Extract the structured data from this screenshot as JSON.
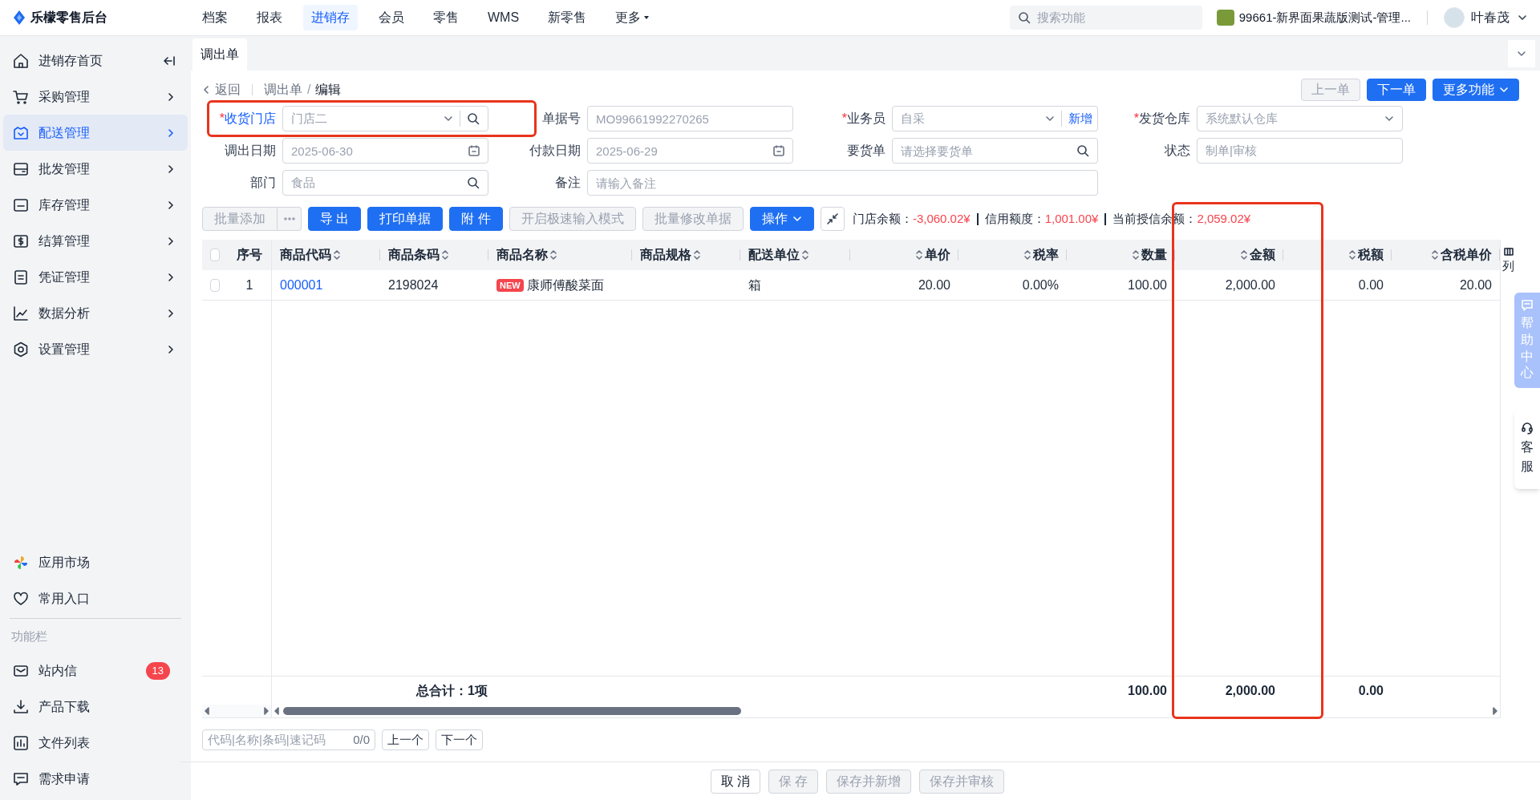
{
  "header": {
    "brand": "乐檬零售后台",
    "nav": [
      {
        "label": "档案",
        "selected": false,
        "has_menu": false
      },
      {
        "label": "报表",
        "selected": false,
        "has_menu": false
      },
      {
        "label": "进销存",
        "selected": true,
        "has_menu": false
      },
      {
        "label": "会员",
        "selected": false,
        "has_menu": false
      },
      {
        "label": "零售",
        "selected": false,
        "has_menu": false
      },
      {
        "label": "WMS",
        "selected": false,
        "has_menu": false
      },
      {
        "label": "新零售",
        "selected": false,
        "has_menu": false
      },
      {
        "label": "更多",
        "selected": false,
        "has_menu": true
      }
    ],
    "search_placeholder": "搜索功能",
    "store": "99661-新界面果蔬版测试-管理...",
    "user": "叶春茂"
  },
  "sidebar": {
    "menu": [
      {
        "label": "进销存首页",
        "selected": false
      },
      {
        "label": "采购管理",
        "selected": false
      },
      {
        "label": "配送管理",
        "selected": true
      },
      {
        "label": "批发管理",
        "selected": false
      },
      {
        "label": "库存管理",
        "selected": false
      },
      {
        "label": "结算管理",
        "selected": false
      },
      {
        "label": "凭证管理",
        "selected": false
      },
      {
        "label": "数据分析",
        "selected": false
      },
      {
        "label": "设置管理",
        "selected": false
      }
    ],
    "links": [
      {
        "label": "应用市场"
      },
      {
        "label": "常用入口"
      }
    ],
    "section_title": "功能栏",
    "tools": [
      {
        "label": "站内信",
        "badge": "13"
      },
      {
        "label": "产品下载"
      },
      {
        "label": "文件列表"
      },
      {
        "label": "需求申请"
      }
    ]
  },
  "page_tabs": [
    {
      "label": "调出单",
      "selected": true
    }
  ],
  "breadcrumb": {
    "back": "返回",
    "path": [
      "调出单",
      "编辑"
    ],
    "separator": "/"
  },
  "record_buttons": [
    {
      "label": "上一单",
      "kind": "default",
      "disabled": true
    },
    {
      "label": "下一单",
      "kind": "primary",
      "disabled": false
    },
    {
      "label": "更多功能",
      "kind": "primary_dropdown",
      "disabled": false
    }
  ],
  "form_fields": [
    {
      "label": "收货门店",
      "required_mark": "*",
      "kind": "select_search",
      "value": "门店二",
      "highlighted": true
    },
    {
      "label": "单据号",
      "kind": "text",
      "value": "MO99661992270265",
      "highlighted": false
    },
    {
      "label": "业务员",
      "required_mark": "*",
      "kind": "select_add",
      "value": "自采",
      "action": "新增",
      "highlighted": false
    },
    {
      "label": "发货仓库",
      "required_mark": "*",
      "kind": "select",
      "value": "系统默认仓库",
      "highlighted": false
    },
    {
      "label": "调出日期",
      "kind": "date",
      "value": "2025-06-30",
      "highlighted": false
    },
    {
      "label": "付款日期",
      "kind": "date",
      "value": "2025-06-29",
      "highlighted": false
    },
    {
      "label": "要货单",
      "kind": "search",
      "placeholder": "请选择要货单",
      "highlighted": false
    },
    {
      "label": "状态",
      "kind": "text",
      "value": "制单|审核",
      "highlighted": false
    },
    {
      "label": "部门",
      "kind": "search",
      "value": "食品",
      "highlighted": false
    },
    {
      "label": "备注",
      "kind": "remark",
      "placeholder": "请输入备注",
      "highlighted": false
    }
  ],
  "toolbar": {
    "buttons": [
      {
        "label": "批量添加",
        "kind": "default",
        "disabled": true
      },
      {
        "kind": "more",
        "disabled": true
      },
      {
        "label": "导 出",
        "kind": "primary",
        "disabled": false
      },
      {
        "label": "打印单据",
        "kind": "primary",
        "disabled": false
      },
      {
        "label": "附 件",
        "kind": "primary",
        "disabled": false
      },
      {
        "label": "开启极速输入模式",
        "kind": "default",
        "disabled": true
      },
      {
        "label": "批量修改单据",
        "kind": "default",
        "disabled": true
      },
      {
        "label": "操作",
        "kind": "primary_dropdown",
        "disabled": false
      },
      {
        "kind": "collapse",
        "disabled": false
      }
    ],
    "balances": [
      {
        "label": "门店余额：",
        "value": "-3,060.02¥"
      },
      {
        "label": "信用额度：",
        "value": "1,001.00¥"
      },
      {
        "label": "当前授信余额：",
        "value": "2,059.02¥"
      }
    ]
  },
  "table": {
    "columns": [
      {
        "kind": "check",
        "checked": false
      },
      {
        "label": "序号",
        "kind": "index",
        "sortable": false
      },
      {
        "label": "商品代码",
        "kind": "link",
        "sortable": true
      },
      {
        "label": "商品条码",
        "kind": "text",
        "sortable": true
      },
      {
        "label": "商品名称",
        "kind": "product",
        "sortable": true
      },
      {
        "label": "商品规格",
        "kind": "text",
        "sortable": true
      },
      {
        "label": "配送单位",
        "kind": "text",
        "sortable": true
      },
      {
        "label": "单价",
        "kind": "number",
        "sortable": true
      },
      {
        "label": "税率",
        "kind": "number",
        "sortable": true
      },
      {
        "label": "数量",
        "kind": "number",
        "sortable": true,
        "total": "100.00"
      },
      {
        "label": "金额",
        "kind": "number",
        "sortable": true,
        "highlighted": true,
        "total": "2,000.00"
      },
      {
        "label": "税额",
        "kind": "number",
        "sortable": true,
        "total": "0.00"
      },
      {
        "label": "含税单价",
        "kind": "number",
        "sortable": true
      }
    ],
    "column_settings": "列",
    "rows": [
      {
        "checked": false,
        "badge": "NEW",
        "cells": [
          null,
          "1",
          "000001",
          "2198024",
          "康师傅酸菜面",
          null,
          "箱",
          "20.00",
          "0.00%",
          "100.00",
          "2,000.00",
          "0.00",
          "20.00"
        ]
      }
    ],
    "footer_label": "总合计：1项"
  },
  "finder": {
    "placeholder": "代码|名称|条码|速记码",
    "count": "0/0",
    "buttons": [
      "上一个",
      "下一个"
    ]
  },
  "actions": [
    {
      "label": "取 消",
      "disabled": false
    },
    {
      "label": "保 存",
      "disabled": true
    },
    {
      "label": "保存并新增",
      "disabled": true
    },
    {
      "label": "保存并审核",
      "disabled": true
    }
  ],
  "float": {
    "help": "帮助中心",
    "service": "客服"
  }
}
